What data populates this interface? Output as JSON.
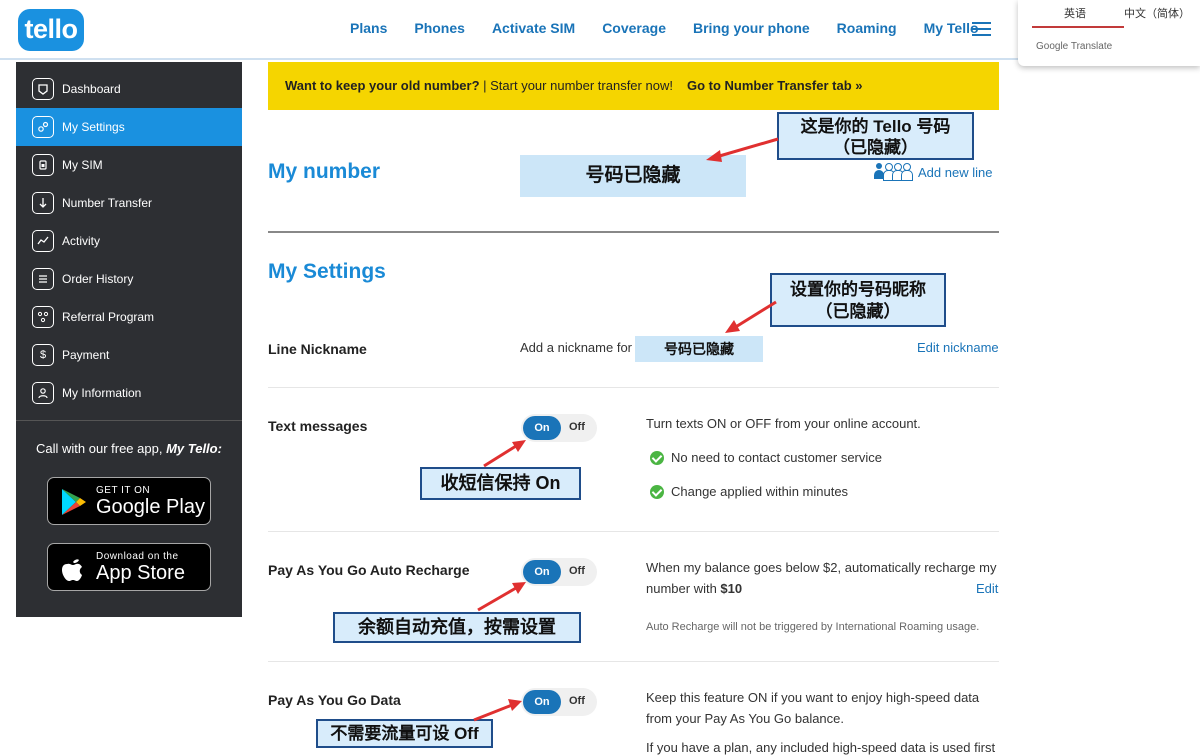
{
  "header": {
    "logo": "tello",
    "nav": [
      "Plans",
      "Phones",
      "Activate SIM",
      "Coverage",
      "Bring your phone",
      "Roaming",
      "My Tello"
    ]
  },
  "translate_popup": {
    "tab_active": "英语",
    "tab_other": "中文（简体）",
    "brand": "Google Translate"
  },
  "sidebar": {
    "items": [
      {
        "label": "Dashboard",
        "icon": "dashboard-icon"
      },
      {
        "label": "My Settings",
        "icon": "settings-icon"
      },
      {
        "label": "My SIM",
        "icon": "sim-icon"
      },
      {
        "label": "Number Transfer",
        "icon": "transfer-icon"
      },
      {
        "label": "Activity",
        "icon": "activity-icon"
      },
      {
        "label": "Order History",
        "icon": "order-history-icon"
      },
      {
        "label": "Referral Program",
        "icon": "referral-icon"
      },
      {
        "label": "Payment",
        "icon": "dollar-icon"
      },
      {
        "label": "My Information",
        "icon": "user-icon"
      }
    ],
    "active_index": 1,
    "call_text_prefix": "Call with our free app, ",
    "call_text_app": "My Tello",
    "call_text_suffix": ":",
    "google_play_small": "GET IT ON",
    "google_play_big": "Google Play",
    "app_store_small": "Download on the",
    "app_store_big": "App Store"
  },
  "banner": {
    "question": "Want to keep your old number?",
    "separator": " | ",
    "text": "Start your number transfer now!",
    "cta": "Go to Number Transfer tab »"
  },
  "my_number": {
    "title": "My number",
    "hidden_value": "号码已隐藏",
    "callout_line1": "这是你的 Tello 号码",
    "callout_line2": "（已隐藏）",
    "add_line": "Add new line"
  },
  "my_settings": {
    "title": "My Settings",
    "nickname": {
      "label": "Line Nickname",
      "prefix": "Add a nickname for",
      "hidden_value": "号码已隐藏",
      "edit": "Edit nickname",
      "callout_line1": "设置你的号码昵称",
      "callout_line2": "（已隐藏）"
    },
    "text_messages": {
      "label": "Text messages",
      "on": "On",
      "off": "Off",
      "desc": "Turn texts ON or OFF from your online account.",
      "check1": "No need to contact customer service",
      "check2": "Change applied within minutes",
      "callout": "收短信保持 On"
    },
    "auto_recharge": {
      "label": "Pay As You Go Auto Recharge",
      "on": "On",
      "off": "Off",
      "desc_line1": "When my balance goes below $2, automatically recharge my",
      "desc_line2_prefix": "number with ",
      "desc_amount": "$10",
      "edit": "Edit",
      "note": "Auto Recharge will not be triggered by International Roaming usage.",
      "callout": "余额自动充值，按需设置"
    },
    "data": {
      "label": "Pay As You Go Data",
      "on": "On",
      "off": "Off",
      "desc_line1": "Keep this feature ON if you want to enjoy high-speed data",
      "desc_line2": "from your Pay As You Go balance.",
      "desc_line3": "If you have a plan, any included high-speed data is used first",
      "callout": "不需要流量可设 Off"
    }
  },
  "colors": {
    "brand_blue": "#1a91e0",
    "link_blue": "#1a74b8",
    "sidebar_bg": "#2d2f33",
    "banner_yellow": "#f5d500",
    "callout_border": "#1f4d8a",
    "arrow_red": "#e03030",
    "check_green": "#4bb543"
  }
}
